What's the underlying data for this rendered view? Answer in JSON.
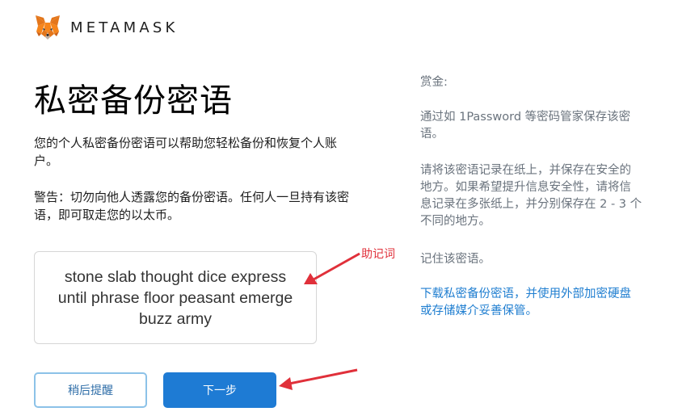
{
  "header": {
    "brand": "METAMASK",
    "logo_icon": "metamask-fox-icon"
  },
  "main": {
    "title": "私密备份密语",
    "description": "您的个人私密备份密语可以帮助您轻松备份和恢复个人账户。",
    "warning": "警告：切勿向他人透露您的备份密语。任何人一旦持有该密语，即可取走您的以太币。",
    "seed_phrase": "stone slab thought dice express until phrase floor peasant emerge buzz army"
  },
  "buttons": {
    "remind_later": "稍后提醒",
    "next": "下一步"
  },
  "annotation": {
    "label": "助记词",
    "color": "#e0303a"
  },
  "sidebar": {
    "title": "赏金:",
    "tip1": "通过如 1Password 等密码管家保存该密语。",
    "tip2": "请将该密语记录在纸上，并保存在安全的地方。如果希望提升信息安全性，请将信息记录在多张纸上，并分别保存在 2 - 3 个不同的地方。",
    "tip3": "记住该密语。",
    "download_link": "下载私密备份密语，并使用外部加密硬盘或存储媒介妥善保管。"
  },
  "colors": {
    "primary": "#1e7bd4",
    "link": "#1f7ed0",
    "secondary_border": "#8cc2e8",
    "muted": "#6a737d"
  }
}
